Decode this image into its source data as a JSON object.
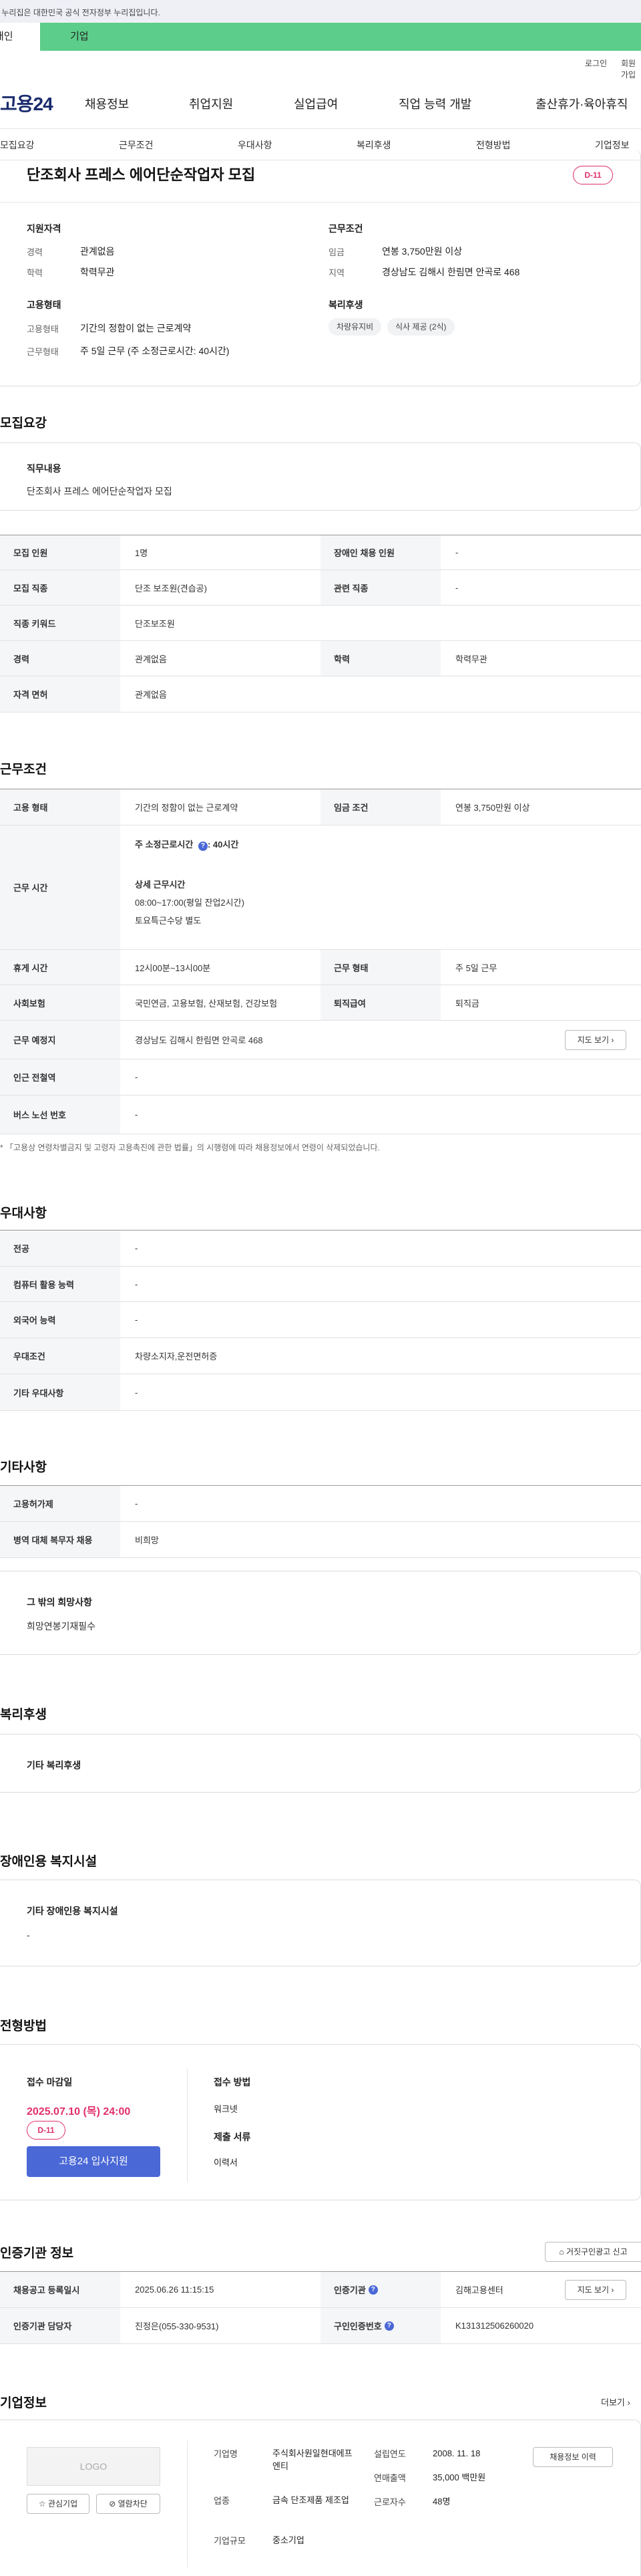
{
  "gov_banner": "이 누리집은 대한민국 공식 전자정부 누리집입니다.",
  "tabs": {
    "person": "개인",
    "company": "기업"
  },
  "util": {
    "login": "로그인",
    "join": "회원가입"
  },
  "logo": {
    "text": "고용",
    "num": "24"
  },
  "gnb": [
    "채용정보",
    "취업지원",
    "실업급여",
    "직업 능력 개발",
    "출산휴가·육아휴직"
  ],
  "subnav": [
    "모집요강",
    "근무조건",
    "우대사항",
    "복리후생",
    "전형방법",
    "기업정보"
  ],
  "job": {
    "title": "단조회사 프레스 에어단순작업자 모집",
    "dday": "D-11",
    "qualification_title": "지원자격",
    "career_label": "경력",
    "career_value": "관계없음",
    "edu_label": "학력",
    "edu_value": "학력무관",
    "employment_title": "고용형태",
    "emp_type_label": "고용형태",
    "emp_type_value": "기간의 정함이 없는 근로계약",
    "work_type_label": "근무형태",
    "work_type_value": "주 5일 근무 (주 소정근로시간: 40시간)",
    "conditions_title": "근무조건",
    "wage_label": "임금",
    "wage_value": "연봉 3,750만원 이상",
    "region_label": "지역",
    "region_value": "경상남도 김해시 한림면 안곡로 468",
    "benefits_title": "복리후생",
    "chips": [
      "차량유지비",
      "식사 제공 (2식)"
    ]
  },
  "recruit": {
    "title": "모집요강",
    "duty_title": "직무내용",
    "duty_text": "단조회사 프레스 에어단순작업자 모집",
    "rows": {
      "count_k": "모집 인원",
      "count_v": "1명",
      "disabled_k": "장애인 채용 인원",
      "disabled_v": "-",
      "job_k": "모집 직종",
      "job_v": "단조 보조원(견습공)",
      "related_k": "관련 직종",
      "related_v": "-",
      "keyword_k": "직종 키워드",
      "keyword_v": "단조보조원",
      "career_k": "경력",
      "career_v": "관계없음",
      "edu_k": "학력",
      "edu_v": "학력무관",
      "license_k": "자격 면허",
      "license_v": "관계없음"
    }
  },
  "work": {
    "title": "근무조건",
    "emp_k": "고용 형태",
    "emp_v": "기간의 정함이 없는 근로계약",
    "wage_k": "임금 조건",
    "wage_v": "연봉 3,750만원 이상",
    "hours_k": "근무 시간",
    "hours_weekly": "주 소정근로시간",
    "hours_weekly_v": ": 40시간",
    "hours_detail_title": "상세 근무시간",
    "hours_detail_1": "08:00~17:00(평일 잔업2시간)",
    "hours_detail_2": "토요특근수당 별도",
    "break_k": "휴게 시간",
    "break_v": "12시00분~13시00분",
    "form_k": "근무 형태",
    "form_v": "주 5일 근무",
    "insurance_k": "사회보험",
    "insurance_v": "국민연금, 고용보험, 산재보험, 건강보험",
    "retire_k": "퇴직급여",
    "retire_v": "퇴직금",
    "place_k": "근무 예정지",
    "place_v": "경상남도 김해시 한림면 안곡로 468",
    "map_btn": "지도 보기",
    "station_k": "인근 전철역",
    "station_v": "-",
    "bus_k": "버스 노선 번호",
    "bus_v": "-",
    "note": "* 「고용상 연령차별금지 및 고령자 고용촉진에 관한 법률」의 시행령에 따라 채용정보에서 연령이 삭제되었습니다."
  },
  "preference": {
    "title": "우대사항",
    "major_k": "전공",
    "major_v": "-",
    "computer_k": "컴퓨터 활용 능력",
    "computer_v": "-",
    "language_k": "외국어 능력",
    "language_v": "-",
    "cond_k": "우대조건",
    "cond_v": "차량소지자,운전면허증",
    "etc_k": "기타 우대사항",
    "etc_v": "-"
  },
  "other": {
    "title": "기타사항",
    "employ_k": "고용허가제",
    "employ_v": "-",
    "military_k": "병역 대체 복무자 채용",
    "military_v": "비희망",
    "hope_title": "그 밖의 희망사항",
    "hope_text": "희망연봉기재필수"
  },
  "welfare": {
    "title": "복리후생",
    "box_title": "기타 복리후생"
  },
  "facility": {
    "title": "장애인용 복지시설",
    "box_title": "기타 장애인용 복지시설",
    "box_text": "-"
  },
  "selection": {
    "title": "전형방법",
    "deadline_title": "접수 마감일",
    "deadline": "2025.07.10 (목) 24:00",
    "dday": "D-11",
    "apply_btn": "고용24 입사지원",
    "method_title": "접수 방법",
    "method_value": "워크넷",
    "docs_title": "제출 서류",
    "docs_value": "이력서"
  },
  "cert": {
    "title": "인증기관 정보",
    "report_btn": "거짓구인광고 신고",
    "reg_k": "채용공고 등록일시",
    "reg_v": "2025.06.26 11:15:15",
    "agency_k": "인증기관",
    "agency_v": "김해고용센터",
    "map_btn": "지도 보기",
    "manager_k": "인증기관 담당자",
    "manager_v": "진정은(055-330-9531)",
    "id_k": "구인인증번호",
    "id_v": "K131312506260020"
  },
  "company": {
    "title": "기업정보",
    "more": "더보기",
    "logo_text": "LOGO",
    "fav_btn": "관심기업",
    "block_btn": "열람차단",
    "name_k": "기업명",
    "name_v": "주식회사원일현대에프엔티",
    "industry_k": "업종",
    "industry_v": "금속 단조제품 제조업",
    "size_k": "기업규모",
    "size_v": "중소기업",
    "founded_k": "설립연도",
    "founded_v": "2008. 11. 18",
    "sales_k": "연매출액",
    "sales_v": "35,000 백만원",
    "workers_k": "근로자수",
    "workers_v": "48명",
    "jobs_btn": "채용정보 이력"
  }
}
